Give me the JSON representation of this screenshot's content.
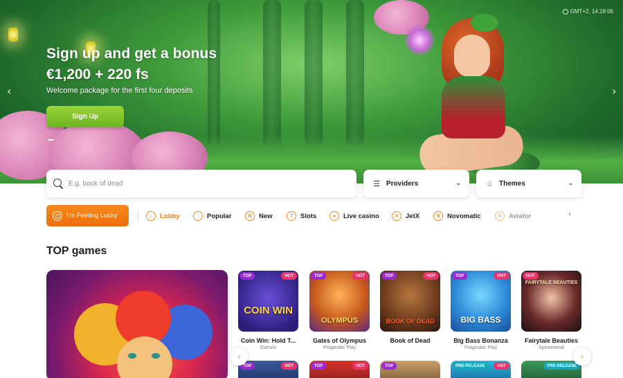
{
  "hero": {
    "clock": "GMT+2, 14:18:06",
    "title_line1": "Sign up and get a bonus",
    "title_line2": "€1,200 + 220 fs",
    "subtitle": "Welcome package for the first four deposits",
    "signup_label": "Sign Up",
    "prev_arrow": "‹",
    "next_arrow": "›"
  },
  "search": {
    "placeholder": "E.g. book of dead"
  },
  "filters": {
    "providers_label": "Providers",
    "themes_label": "Themes",
    "chevron": "⌄"
  },
  "nav": {
    "lucky_label": "I'm Feeling Lucky",
    "items": [
      {
        "label": "Lobby",
        "icon": "home-icon",
        "glyph": "⌂"
      },
      {
        "label": "Popular",
        "icon": "heart-icon",
        "glyph": "♡"
      },
      {
        "label": "New",
        "icon": "new-icon",
        "glyph": "N"
      },
      {
        "label": "Slots",
        "icon": "slots-icon",
        "glyph": "7"
      },
      {
        "label": "Live casino",
        "icon": "live-icon",
        "glyph": "●"
      },
      {
        "label": "JetX",
        "icon": "jetx-icon",
        "glyph": "X"
      },
      {
        "label": "Novomatic",
        "icon": "novomatic-icon",
        "glyph": "N"
      },
      {
        "label": "Aviator",
        "icon": "aviator-icon",
        "glyph": "S"
      }
    ],
    "scroll_right": "›"
  },
  "top_games": {
    "title": "TOP games",
    "cards": [
      {
        "name": "Coin Win: Hold T...",
        "provider": "Gamzix",
        "badge_left": "TOP",
        "badge_right": "HOT",
        "art": "COIN WIN"
      },
      {
        "name": "Gates of Olympus",
        "provider": "Pragmatic Play",
        "badge_left": "TOP",
        "badge_right": "HOT",
        "art": "OLYMPUS"
      },
      {
        "name": "Book of Dead",
        "provider": "",
        "badge_left": "TOP",
        "badge_right": "HOT",
        "art": "BOOK OF DEAD"
      },
      {
        "name": "Big Bass Bonanza",
        "provider": "Pragmatic Play",
        "badge_left": "TOP",
        "badge_right": "HOT",
        "art": "BIG BASS"
      },
      {
        "name": "Fairytale Beauties",
        "provider": "Spinomenal",
        "badge_left": "HOT",
        "badge_right": "",
        "art": "FAIRYTALE BEAUTIES"
      }
    ],
    "row2_badges": [
      {
        "left": "TOP",
        "right": "HOT"
      },
      {
        "left": "TOP",
        "right": "HOT"
      },
      {
        "left": "TOP",
        "right": ""
      },
      {
        "left": "PRE-RELEASE",
        "right": "HOT"
      },
      {
        "left": "",
        "right": "PRE-RELEASE"
      }
    ],
    "prev_button": "‹",
    "next_button": "›"
  },
  "colors": {
    "accent": "#f07a15",
    "signup_green": "#7bc02a",
    "top_badge": "#9b2bd1",
    "hot_badge": "#e8336a",
    "pre_release_badge": "#1aa6b8"
  }
}
